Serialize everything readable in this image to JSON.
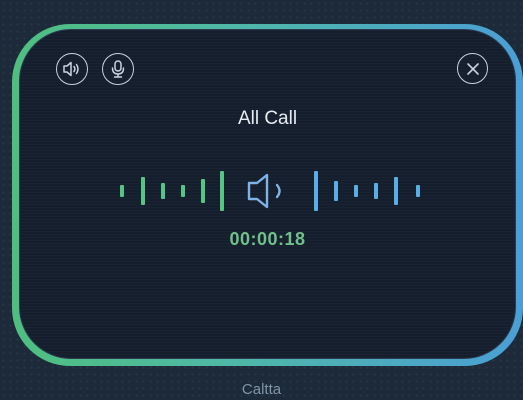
{
  "call": {
    "title": "All Call",
    "timer": "00:00:18"
  },
  "toolbar": {
    "speaker_icon": "speaker-icon",
    "mic_icon": "microphone-icon",
    "close_icon": "close-icon"
  },
  "wave": {
    "center_icon": "speaker-icon"
  },
  "footer": {
    "name": "Caltta"
  },
  "colors": {
    "frame_start": "#4fbf7e",
    "frame_end": "#4a9fd6",
    "panel": "#151e2c",
    "timer": "#6fc08a"
  }
}
